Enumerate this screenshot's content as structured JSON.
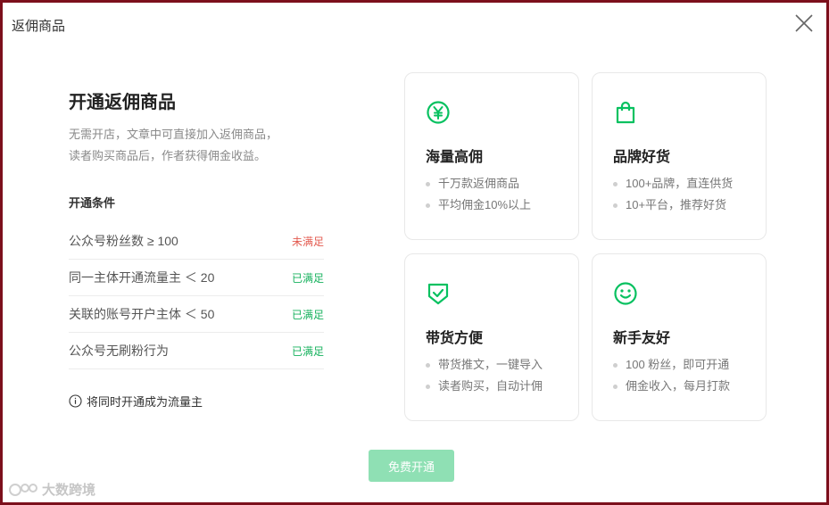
{
  "modal": {
    "title": "返佣商品"
  },
  "intro": {
    "heading": "开通返佣商品",
    "desc_line1": "无需开店，文章中可直接加入返佣商品，",
    "desc_line2": "读者购买商品后，作者获得佣金收益。"
  },
  "conditions": {
    "title": "开通条件",
    "items": [
      {
        "label": "公众号粉丝数 ≥ 100",
        "status": "未满足"
      },
      {
        "label": "同一主体开通流量主 ＜ 20",
        "status": "已满足"
      },
      {
        "label": "关联的账号开户主体 ＜ 50",
        "status": "已满足"
      },
      {
        "label": "公众号无刷粉行为",
        "status": "已满足"
      }
    ]
  },
  "note": "将同时开通成为流量主",
  "features": [
    {
      "icon": "yen-coin-icon",
      "title": "海量高佣",
      "points": [
        "千万款返佣商品",
        "平均佣金10%以上"
      ]
    },
    {
      "icon": "shopping-bag-icon",
      "title": "品牌好货",
      "points": [
        "100+品牌，直连供货",
        "10+平台，推荐好货"
      ]
    },
    {
      "icon": "shield-check-icon",
      "title": "带货方便",
      "points": [
        "带货推文，一键导入",
        "读者购买，自动计佣"
      ]
    },
    {
      "icon": "smile-face-icon",
      "title": "新手友好",
      "points": [
        "100 粉丝，即可开通",
        "佣金收入，每月打款"
      ]
    }
  ],
  "action": {
    "open_label": "免费开通"
  },
  "watermark": {
    "text": "大数跨境"
  },
  "colors": {
    "accent": "#07c160",
    "button_disabled": "#8fe0b4",
    "unmet": "#e35a4f",
    "met": "#17b25e"
  }
}
